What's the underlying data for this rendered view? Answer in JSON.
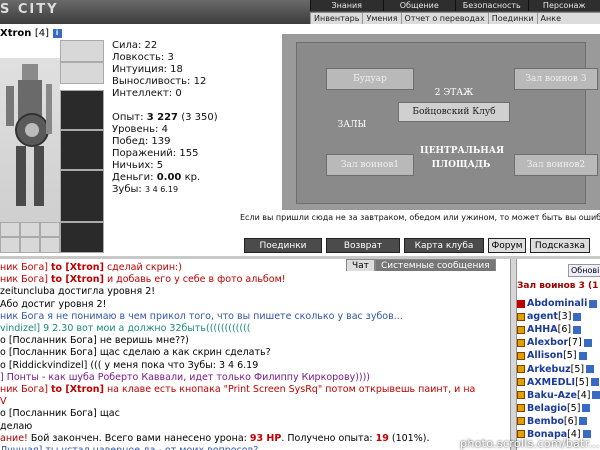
{
  "header": {
    "logo_text": "S CITY",
    "menu_top": [
      "Знания",
      "Общение",
      "Безопасность",
      "Персонаж"
    ],
    "menu_sub": [
      "Инвентарь",
      "Умения",
      "Отчет о переводах",
      "Поединки",
      "Анке"
    ]
  },
  "character": {
    "name": "Xtron",
    "level": "[4]",
    "info_icon": "i"
  },
  "stats": [
    "Сила: 22",
    "Ловкость: 3",
    "Интуиция: 18",
    "Выносливость: 12",
    "Интеллект: 0"
  ],
  "progress": {
    "experience_label": "Опыт:",
    "experience": "3 227",
    "experience_next": "(3 350)",
    "level_line": "Уровень: 4",
    "wins": "Побед: 139",
    "losses": "Поражений: 155",
    "draws": "Ничьих: 5",
    "money_label": "Деньги:",
    "money": "0.00",
    "money_unit": "кр.",
    "teeth_label": "Зубы:",
    "teeth": "3 4 6.19"
  },
  "map": {
    "rooms": [
      "Будуар",
      "Зал воинов 3",
      "2 ЭТАЖ",
      "Бойцовский Клуб",
      "ЗАЛЫ",
      "Зал воинов1",
      "ЦЕНТРАЛЬНАЯ ПЛОЩАДЬ",
      "Зал воинов2"
    ],
    "hint": "Если вы пришли сюда не за завтраком, обедом или ужином, то может быть вы ошибл"
  },
  "navigation": [
    "Поединки",
    "Возврат",
    "Карта клуба",
    "Форум",
    "Подсказка"
  ],
  "chat_tabs": [
    "Чат",
    "Системные сообщения"
  ],
  "chat": [
    {
      "parts": [
        {
          "c": "msg-rd",
          "t": "ник Бога] "
        },
        {
          "c": "to",
          "t": "to [Xtron]"
        },
        {
          "c": "msg-rd",
          "t": " сделай скрин:)"
        }
      ]
    },
    {
      "parts": [
        {
          "c": "msg-rd",
          "t": "ник Бога] "
        },
        {
          "c": "to",
          "t": "to [Xtron]"
        },
        {
          "c": "msg-rd",
          "t": " и добавь его у себе в фото альбом!"
        }
      ]
    },
    {
      "parts": [
        {
          "c": "msg-dk",
          "t": "zeituncluba"
        },
        {
          "c": "msg-dk",
          "t": " достигла уровня 2!"
        }
      ]
    },
    {
      "parts": [
        {
          "c": "msg-dk",
          "t": "Або достиг уровня 2!"
        }
      ]
    },
    {
      "parts": [
        {
          "c": "msg-bl",
          "t": "ник Бога я не понимаю в чем прикол того, что вы пишете сколько у вас зубов..."
        }
      ]
    },
    {
      "parts": [
        {
          "c": "msg-tl",
          "t": "vindizel] 9 2.30 вот мои а должно 32быть(((((((((((("
        }
      ]
    },
    {
      "parts": [
        {
          "c": "msg-dk",
          "t": "o [Посланник Бога] не веришь мне??)"
        }
      ]
    },
    {
      "parts": [
        {
          "c": "msg-dk",
          "t": "o [Посланник Бога] щас сделаю а как скрин сделать?"
        }
      ]
    },
    {
      "parts": [
        {
          "c": "msg-dk",
          "t": "o [Riddickvindizel] ((( у меня пока что Зубы: 3 4 6.19"
        }
      ]
    },
    {
      "parts": [
        {
          "c": "msg-pu",
          "t": "] Понты - как шуба Роберто Каввали, идет только Филиппу Киркорову))))"
        }
      ]
    },
    {
      "parts": [
        {
          "c": "msg-rd",
          "t": "ник Бога] "
        },
        {
          "c": "to",
          "t": "to [Xtron]"
        },
        {
          "c": "msg-rd",
          "t": " на клаве есть кнопака \"Print Screen SysRq\" потом открывешь паинт, и на"
        }
      ]
    },
    {
      "parts": [
        {
          "c": "msg-rd",
          "t": "V"
        }
      ]
    },
    {
      "parts": [
        {
          "c": "msg-dk",
          "t": "o [Посланник Бога] щас"
        }
      ]
    },
    {
      "parts": [
        {
          "c": "msg-dk",
          "t": "делаю"
        }
      ]
    },
    {
      "parts": [
        {
          "c": "sys",
          "t": "ание! "
        },
        {
          "c": "msg-dk",
          "t": "Бой закончен. Всего вами нанесено урона: "
        },
        {
          "c": "to",
          "t": "93 HP"
        },
        {
          "c": "msg-dk",
          "t": ". Получено опыта: "
        },
        {
          "c": "to",
          "t": "19"
        },
        {
          "c": "msg-dk",
          "t": " (101%)."
        }
      ]
    },
    {
      "parts": [
        {
          "c": "msg-bl",
          "t": "Лучшая] ты устал наверное да - от моих вопросов?"
        }
      ]
    }
  ],
  "sidebar": {
    "refresh_label": "Обнові",
    "header": "Зал воинов 3 (1",
    "warriors": [
      {
        "name": "Abdominali",
        "level": ""
      },
      {
        "name": "agent",
        "level": "[3]"
      },
      {
        "name": "AHHA",
        "level": "[6]"
      },
      {
        "name": "Alexbor",
        "level": "[7]"
      },
      {
        "name": "Allison",
        "level": "[5]"
      },
      {
        "name": "Arkebuz",
        "level": "[5]"
      },
      {
        "name": "AXMEDLI",
        "level": "[5]"
      },
      {
        "name": "Baku-Aze",
        "level": "[4]"
      },
      {
        "name": "Belagio",
        "level": "[5]"
      },
      {
        "name": "Bembo",
        "level": "[6]"
      },
      {
        "name": "Bonapa",
        "level": "[4]"
      }
    ]
  },
  "watermark": "photo.scrolls.com/batr..."
}
